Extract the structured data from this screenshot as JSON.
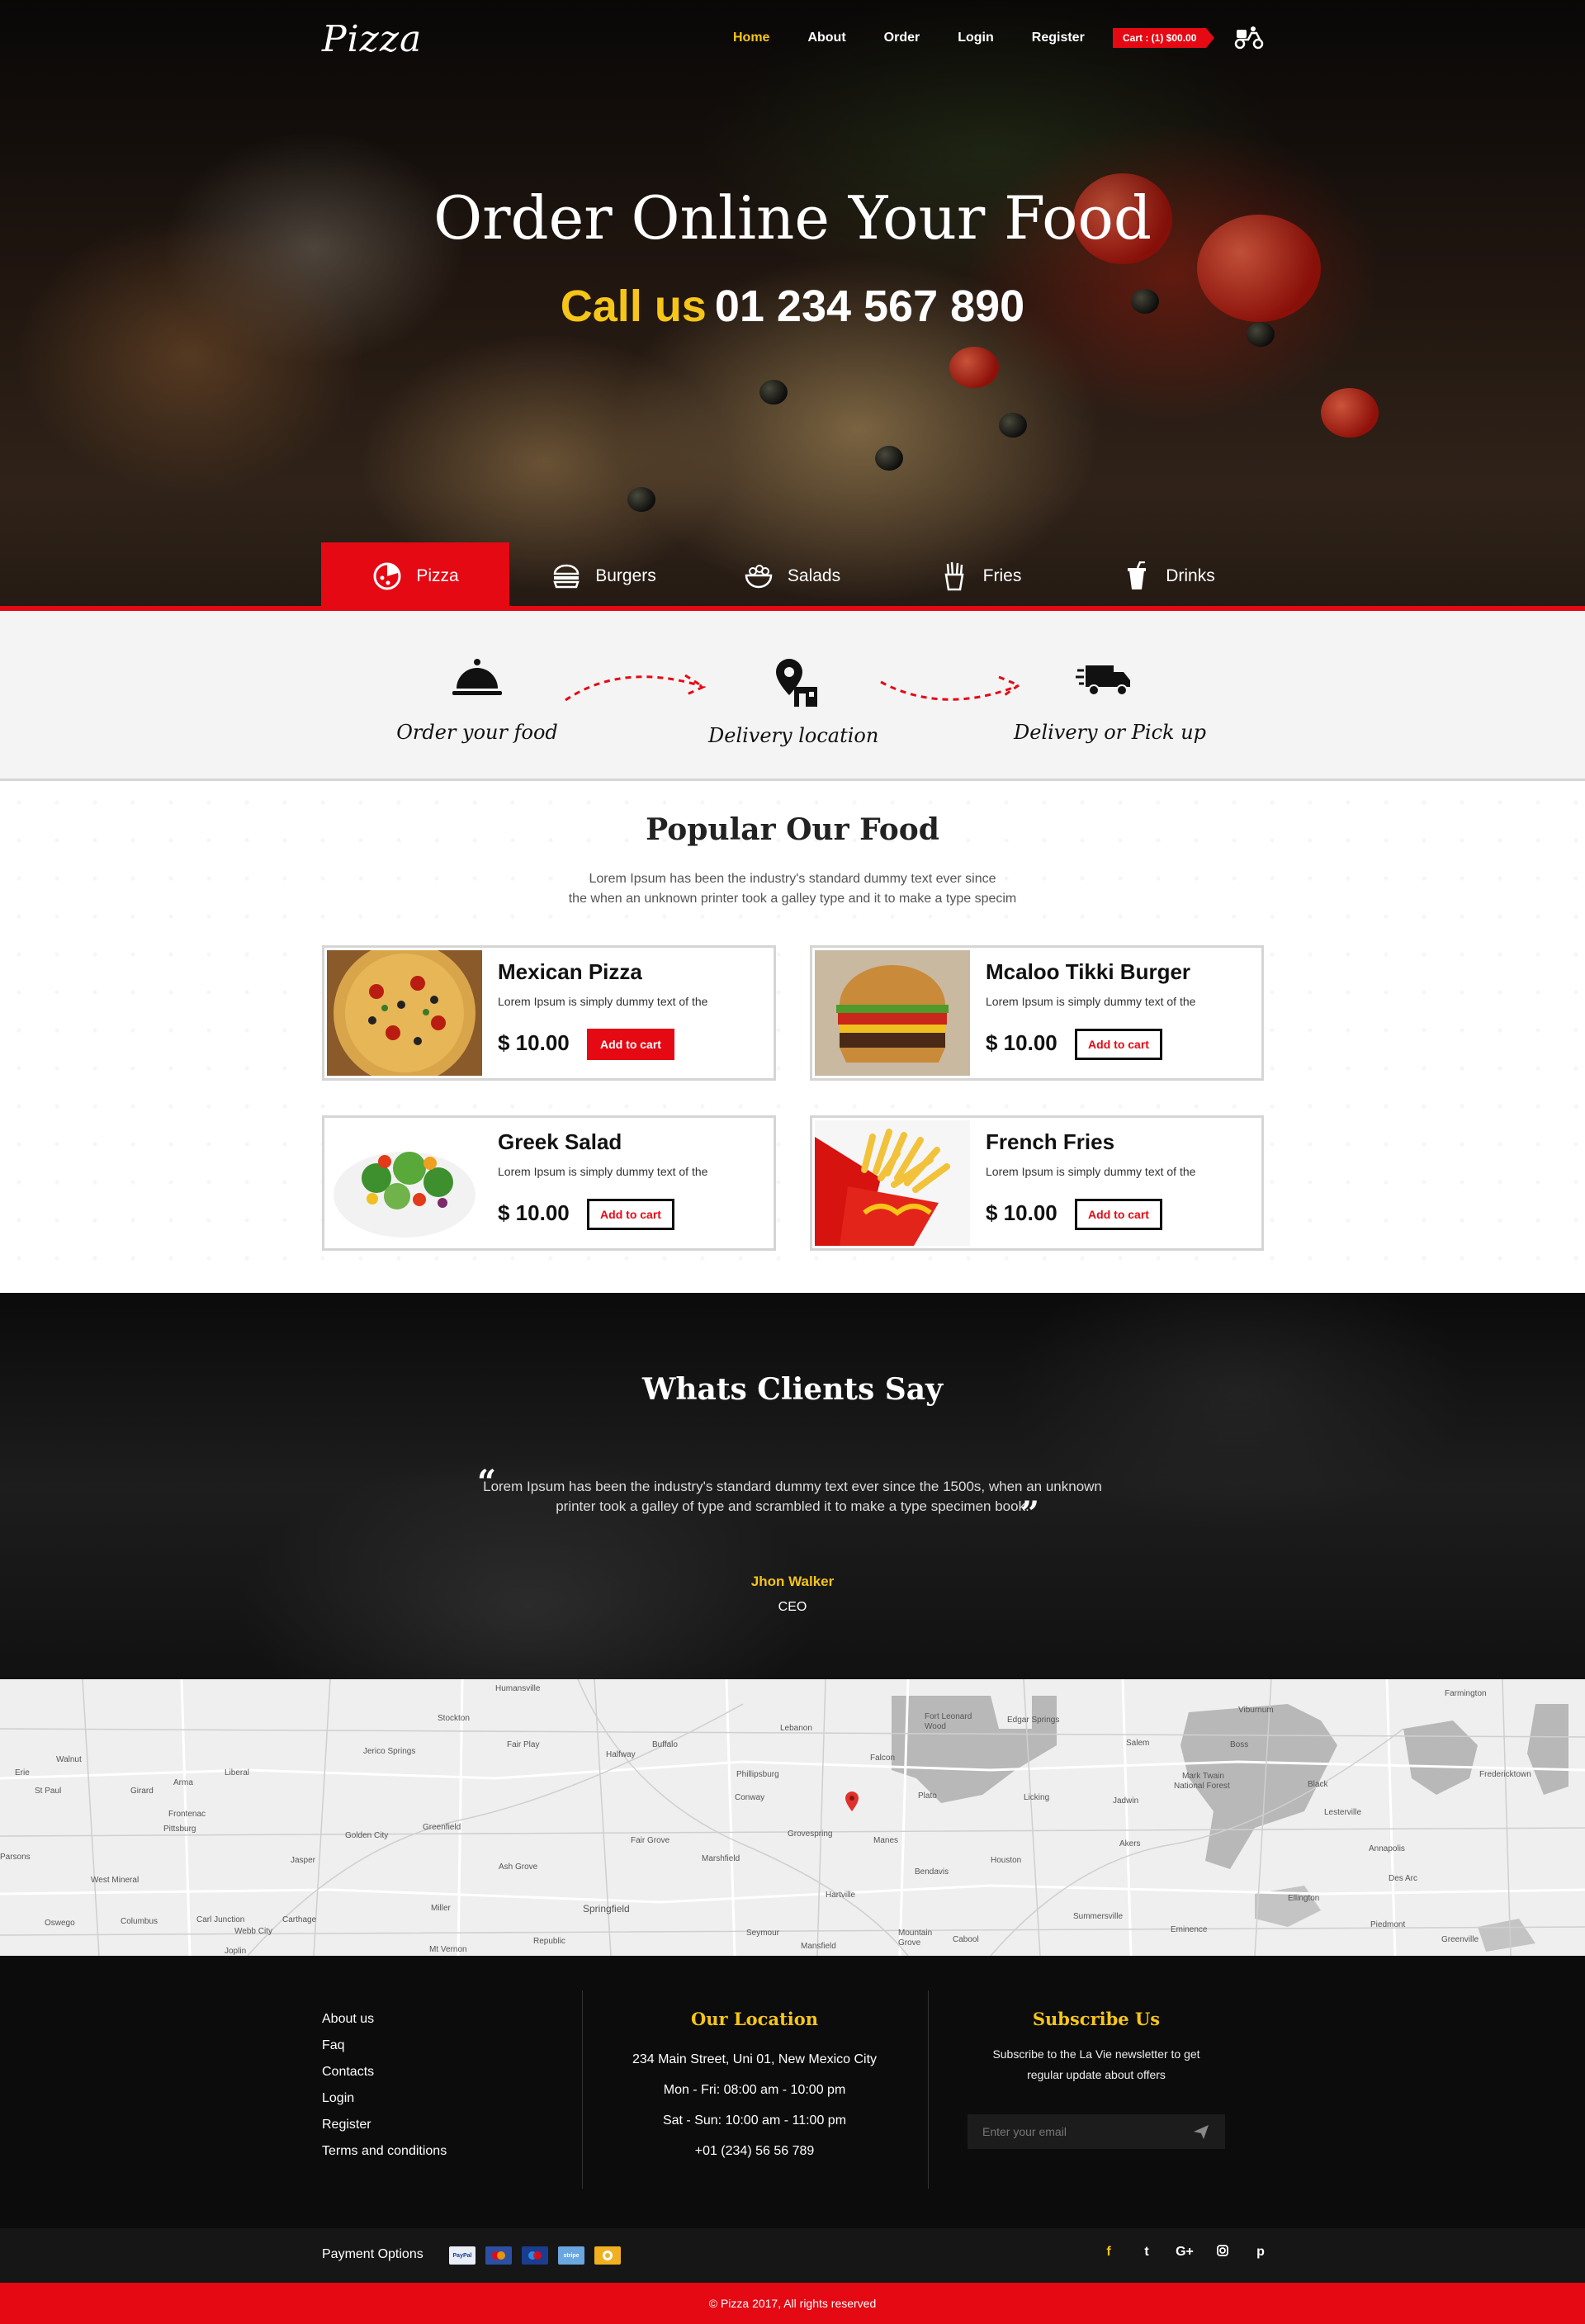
{
  "header": {
    "logo": "Pizza",
    "menu": [
      "Home",
      "About",
      "Order",
      "Login",
      "Register"
    ],
    "active_menu": "Home",
    "cart": "Cart : (1) $00.00"
  },
  "hero": {
    "title": "Order Online Your Food",
    "call_label": "Call us",
    "phone": "01 234 567 890"
  },
  "categories": [
    {
      "label": "Pizza",
      "icon": "pizza-icon",
      "active": true
    },
    {
      "label": "Burgers",
      "icon": "burger-icon",
      "active": false
    },
    {
      "label": "Salads",
      "icon": "salad-icon",
      "active": false
    },
    {
      "label": "Fries",
      "icon": "fries-icon",
      "active": false
    },
    {
      "label": "Drinks",
      "icon": "drink-icon",
      "active": false
    }
  ],
  "steps": [
    {
      "label": "Order your food",
      "icon": "cloche-icon"
    },
    {
      "label": "Delivery location",
      "icon": "location-pin-icon"
    },
    {
      "label": "Delivery or Pick up",
      "icon": "delivery-truck-icon"
    }
  ],
  "popular": {
    "title": "Popular Our Food",
    "subtitle_line1": "Lorem Ipsum has been the industry's standard dummy text ever since",
    "subtitle_line2": "the when an unknown printer took a galley type and it to make a type specim",
    "items": [
      {
        "name": "Mexican Pizza",
        "desc": "Lorem Ipsum is simply dummy text of the",
        "price": "$ 10.00",
        "button": "Add to cart"
      },
      {
        "name": "Mcaloo Tikki Burger",
        "desc": "Lorem Ipsum is simply dummy text of the",
        "price": "$ 10.00",
        "button": "Add to cart"
      },
      {
        "name": "Greek Salad",
        "desc": "Lorem Ipsum is simply dummy text of the",
        "price": "$ 10.00",
        "button": "Add to cart"
      },
      {
        "name": "French Fries",
        "desc": "Lorem Ipsum is simply dummy text of the",
        "price": "$ 10.00",
        "button": "Add to cart"
      }
    ]
  },
  "testimonial": {
    "title": "Whats Clients Say",
    "quote_line1": "Lorem Ipsum has been the industry's standard dummy text ever since the 1500s, when an unknown",
    "quote_line2": "printer took a galley of type and scrambled it to make a type specimen book.",
    "name": "Jhon Walker",
    "role": "CEO"
  },
  "map": {
    "places": [
      "Humansville",
      "Stockton",
      "Lebanon",
      "Fort Leonard Wood",
      "Edgar Springs",
      "Salem",
      "Viburnum",
      "Farmington",
      "Walnut",
      "Arma",
      "Liberal",
      "Jerico Springs",
      "Fair Play",
      "Buffalo",
      "Halfway",
      "Phillipsburg",
      "Falcon",
      "Boss",
      "Mark Twain National Forest",
      "Fredericktown",
      "Girard",
      "Frontenac",
      "Pittsburg",
      "Golden City",
      "Greenfield",
      "Conway",
      "Grovespring",
      "Plato",
      "Licking",
      "Jadwin",
      "Black",
      "Lesterville",
      "Parsons",
      "West Mineral",
      "Jasper",
      "Ash Grove",
      "Fair Grove",
      "Marshfield",
      "Manes",
      "Bendavis",
      "Houston",
      "Akers",
      "Annapolis",
      "Des Arc",
      "Oswego",
      "Columbus",
      "Carl Junction",
      "Webb City",
      "Carthage",
      "Miller",
      "Springfield",
      "Hartville",
      "Summersville",
      "Ellington",
      "Piedmont",
      "Republic",
      "Seymour",
      "Mansfield",
      "Mountain Grove",
      "Cabool",
      "Eminence",
      "Greenville",
      "Mt Vernon",
      "Joplin",
      "Erie",
      "St Paul"
    ]
  },
  "footer": {
    "links": [
      "About us",
      "Faq",
      "Contacts",
      "Login",
      "Register",
      "Terms and conditions"
    ],
    "location_title": "Our Location",
    "address": "234 Main Street, Uni 01, New Mexico City",
    "hours_weekday": "Mon - Fri: 08:00 am - 10:00 pm",
    "hours_weekend": "Sat - Sun: 10:00 am - 11:00 pm",
    "phone": "+01 (234) 56 56 789",
    "subscribe_title": "Subscribe Us",
    "subscribe_line1": "Subscribe to the La Vie newsletter to get",
    "subscribe_line2": "regular update about offers",
    "email_placeholder": "Enter your email"
  },
  "payment": {
    "label": "Payment Options",
    "cards": [
      {
        "name": "PayPal",
        "color": "#e9eef7"
      },
      {
        "name": "MasterCard",
        "color": "#2d4fa3"
      },
      {
        "name": "Maestro",
        "color": "#1a3d8f"
      },
      {
        "name": "Stripe",
        "color": "#6aa6e0"
      },
      {
        "name": "Bitcoin",
        "color": "#f0b020"
      }
    ],
    "social": [
      "f",
      "t",
      "G+",
      "ig",
      "p"
    ]
  },
  "copyright": "© Pizza 2017, All rights reserved",
  "colors": {
    "brand_red": "#e50914",
    "accent_yellow": "#f5c518"
  }
}
